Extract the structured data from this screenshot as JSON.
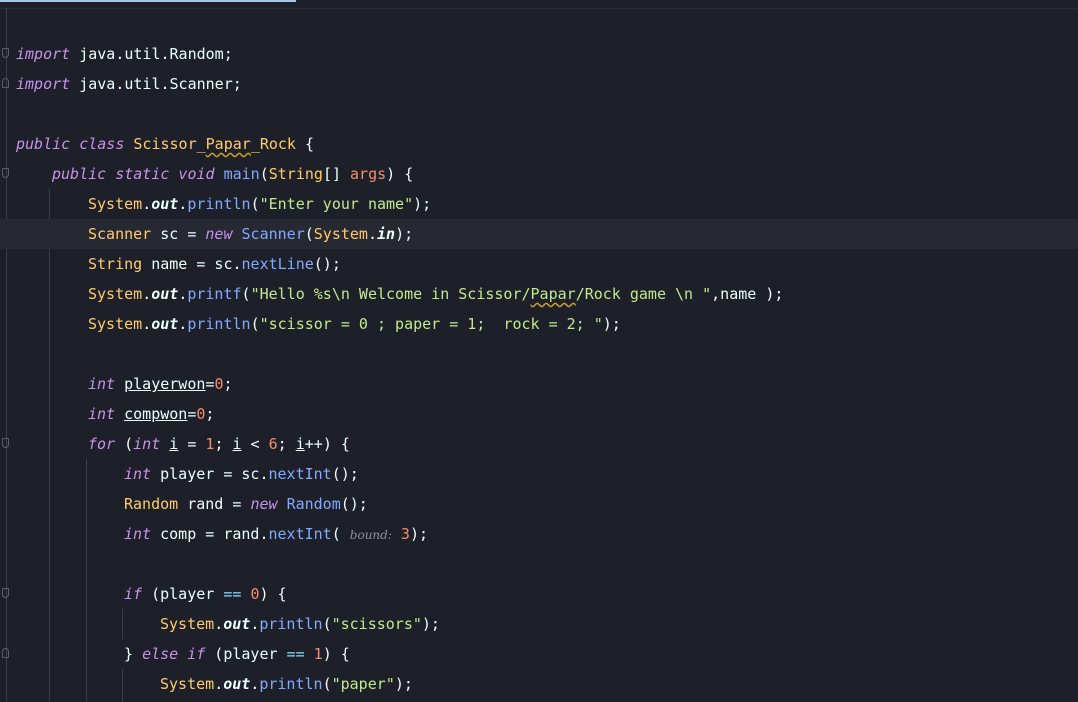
{
  "editor": {
    "language": "Java",
    "colors": {
      "background": "#1e2029",
      "current_line": "#262832",
      "keyword": "#c792ea",
      "type": "#ffcb6b",
      "method": "#82aaff",
      "string": "#c3e88d",
      "number": "#f78c6c",
      "tab_indicator": "#a8c8e8"
    }
  },
  "code": {
    "l1": {
      "kw": "import",
      "rest": " java.util.Random;"
    },
    "l2": {
      "kw": "import",
      "rest": " java.util.Scanner;"
    },
    "l4": {
      "kw": "public class",
      "cls_a": "Scissor_",
      "cls_b": "Papar",
      "cls_c": "_Rock",
      "brace": " {"
    },
    "l5": {
      "kw": "public static void",
      "fn": "main",
      "p1": "(",
      "ty": "String",
      "p2": "[] ",
      "arg": "args",
      "p3": ") {"
    },
    "l6": {
      "ty": "System",
      "dot1": ".",
      "fd": "out",
      "dot2": ".",
      "fn": "println",
      "p1": "(",
      "st": "\"Enter your name\"",
      "p2": ");"
    },
    "l7": {
      "ty": "Scanner",
      "a": " sc = ",
      "kw": "new",
      "sp": " ",
      "fn": "Scanner",
      "p1": "(",
      "ty2": "System",
      "dot": ".",
      "fd": "in",
      "p2": ");"
    },
    "l8": {
      "ty": "String",
      "a": " name = sc.",
      "fn": "nextLine",
      "p": "();"
    },
    "l9": {
      "ty": "System",
      "dot1": ".",
      "fd": "out",
      "dot2": ".",
      "fn": "printf",
      "p1": "(",
      "st_a": "\"Hello %s\\n Welcome in Scissor/",
      "st_b": "Papar",
      "st_c": "/Rock game \\n \"",
      "p2": ",name );"
    },
    "l10": {
      "ty": "System",
      "dot1": ".",
      "fd": "out",
      "dot2": ".",
      "fn": "println",
      "p1": "(",
      "st": "\"scissor = 0 ; paper = 1;  rock = 2; \"",
      "p2": ");"
    },
    "l12": {
      "kw": "int",
      "sp": " ",
      "var": "playerwon",
      "eq": "=",
      "nm": "0",
      "semi": ";"
    },
    "l13": {
      "kw": "int",
      "sp": " ",
      "var": "compwon",
      "eq": "=",
      "nm": "0",
      "semi": ";"
    },
    "l14": {
      "kw": "for",
      "p1": " (",
      "kw2": "int",
      "sp": " ",
      "i1": "i",
      "eq": " = ",
      "n1": "1",
      "s1": "; ",
      "i2": "i",
      "lt": " < ",
      "n2": "6",
      "s2": "; ",
      "i3": "i",
      "inc": "++",
      "p2": ") {"
    },
    "l15": {
      "kw": "int",
      "a": " player = sc.",
      "fn": "nextInt",
      "p": "();"
    },
    "l16": {
      "ty": "Random",
      "a": " rand = ",
      "kw": "new",
      "sp": " ",
      "fn": "Random",
      "p": "();"
    },
    "l17": {
      "kw": "int",
      "a": " comp = rand.",
      "fn": "nextInt",
      "p1": "( ",
      "hint": "bound:",
      "sp": " ",
      "nm": "3",
      "p2": ");"
    },
    "l19": {
      "kw": "if",
      "a": " (player ",
      "op": "==",
      "sp": " ",
      "nm": "0",
      "p": ") {"
    },
    "l20": {
      "ty": "System",
      "dot1": ".",
      "fd": "out",
      "dot2": ".",
      "fn": "println",
      "p1": "(",
      "st": "\"scissors\"",
      "p2": ");"
    },
    "l21": {
      "a": "} ",
      "kw": "else if",
      "b": " (player ",
      "op": "==",
      "sp": " ",
      "nm": "1",
      "p": ") {"
    },
    "l22": {
      "ty": "System",
      "dot1": ".",
      "fd": "out",
      "dot2": ".",
      "fn": "println",
      "p1": "(",
      "st": "\"paper\"",
      "p2": ");"
    }
  }
}
